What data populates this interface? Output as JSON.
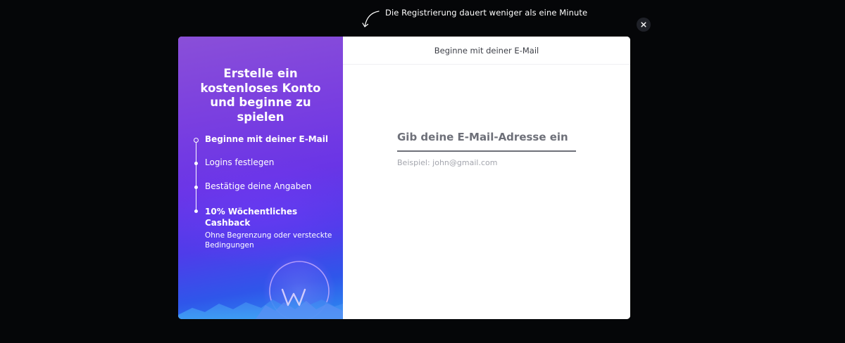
{
  "hint": {
    "text": "Die Registrierung dauert weniger als eine Minute"
  },
  "close": {
    "icon": "close-icon"
  },
  "promo": {
    "title": "Erstelle ein kostenloses Konto und beginne zu spielen",
    "steps": [
      {
        "label": "Beginne mit deiner E-Mail",
        "active": true
      },
      {
        "label": "Logins festlegen",
        "active": false
      },
      {
        "label": "Bestätige deine Angaben",
        "active": false
      },
      {
        "label": "10% Wöchentliches Cashback",
        "active": false
      }
    ],
    "bonus_subtext": "Ohne Begrenzung oder versteckte Bedingungen",
    "logo_icon": "w-logo-icon"
  },
  "form": {
    "header": "Beginne mit deiner E-Mail",
    "email_label": "Gib deine E-Mail-Adresse ein",
    "email_value": "",
    "email_hint": "Beispiel: john@gmail.com"
  },
  "colors": {
    "page_background": "#050608",
    "promo_gradient_top": "#8a4fd8",
    "promo_gradient_bottom": "#2c8ff0",
    "modal_background": "#ffffff"
  }
}
